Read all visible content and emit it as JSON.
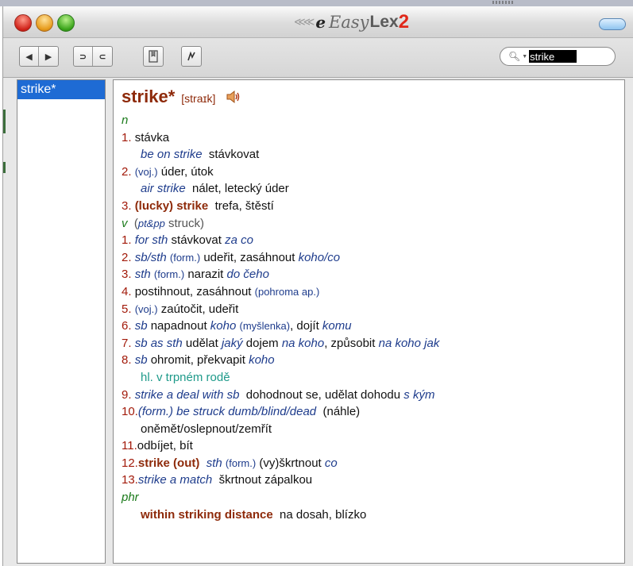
{
  "app": {
    "title_prefix": "e",
    "title_easy": "Easy",
    "title_lex": "Lex",
    "title_version": "2"
  },
  "toolbar": {
    "back_icon": "arrow-left-icon",
    "forward_icon": "arrow-right-icon",
    "undo_icon": "undo-icon",
    "redo_icon": "redo-icon",
    "bookmark_icon": "bookmark-icon",
    "flash_icon": "flash-icon"
  },
  "search": {
    "value": "strike"
  },
  "wordlist": {
    "items": [
      "strike*"
    ]
  },
  "entry": {
    "headword": "strike*",
    "pron": "[straɪk]",
    "n_label": "n",
    "v_label": "v",
    "v_forms_label": "pt&pp",
    "v_forms": "struck",
    "phr_label": "phr",
    "lines": {
      "n1_num": "1.",
      "n1_text": "stávka",
      "n1_ex": "be on strike",
      "n1_ex_tr": "stávkovat",
      "n2_num": "2.",
      "n2_hint": "(voj.)",
      "n2_text": "úder, útok",
      "n2_ex": "air strike",
      "n2_ex_tr": "nálet, letecký úder",
      "n3_num": "3.",
      "n3_bold": "(lucky) strike",
      "n3_text": "trefa, štěstí",
      "v1_num": "1.",
      "v1_ex": "for sth",
      "v1_text": "stávkovat",
      "v1_ex2": "za co",
      "v2_num": "2.",
      "v2_ex": "sb/sth",
      "v2_hint": "(form.)",
      "v2_text": "udeřit, zasáhnout",
      "v2_ex2": "koho/co",
      "v3_num": "3.",
      "v3_ex": "sth",
      "v3_hint": "(form.)",
      "v3_text": "narazit",
      "v3_ex2": "do čeho",
      "v4_num": "4.",
      "v4_text": "postihnout, zasáhnout",
      "v4_hint": "(pohroma ap.)",
      "v5_num": "5.",
      "v5_hint": "(voj.)",
      "v5_text": "zaútočit, udeřit",
      "v6_num": "6.",
      "v6_ex": "sb",
      "v6_text": "napadnout",
      "v6_ex2": "koho",
      "v6_hint": "(myšlenka)",
      "v6_text2": ", dojít",
      "v6_ex3": "komu",
      "v7_num": "7.",
      "v7_ex": "sb as sth",
      "v7_text": "udělat",
      "v7_ex2": "jaký",
      "v7_text2": "dojem",
      "v7_ex3": "na koho",
      "v7_text3": ", způsobit",
      "v7_ex4": "na koho jak",
      "v8_num": "8.",
      "v8_ex": "sb",
      "v8_text": "ohromit, překvapit",
      "v8_ex2": "koho",
      "v8_note": "hl. v trpném rodě",
      "v9_num": "9.",
      "v9_ex": "strike a deal",
      "v9_ex2": "with sb",
      "v9_text": "dohodnout se, udělat dohodu",
      "v9_ex3": "s kým",
      "v10_num": "10.",
      "v10_ex": "(form.) be struck dumb/blind/dead",
      "v10_text": "(náhle)",
      "v10_cont": "oněmět/oslepnout/zemřít",
      "v11_num": "11.",
      "v11_text": "odbíjet, bít",
      "v12_num": "12.",
      "v12_bold": "strike (out)",
      "v12_ex": "sth",
      "v12_hint": "(form.)",
      "v12_text": "(vy)škrtnout",
      "v12_ex2": "co",
      "v13_num": "13.",
      "v13_ex": "strike a match",
      "v13_text": "škrtnout zápalkou",
      "phr1_bold": "within striking distance",
      "phr1_text": "na dosah, blízko"
    }
  },
  "colors": {
    "headword": "#8e2a0a",
    "number": "#a21a0a",
    "example": "#1e3c8c",
    "pos": "#1a7a1a",
    "note": "#1e9a8a",
    "selection": "#1e6bd4"
  }
}
